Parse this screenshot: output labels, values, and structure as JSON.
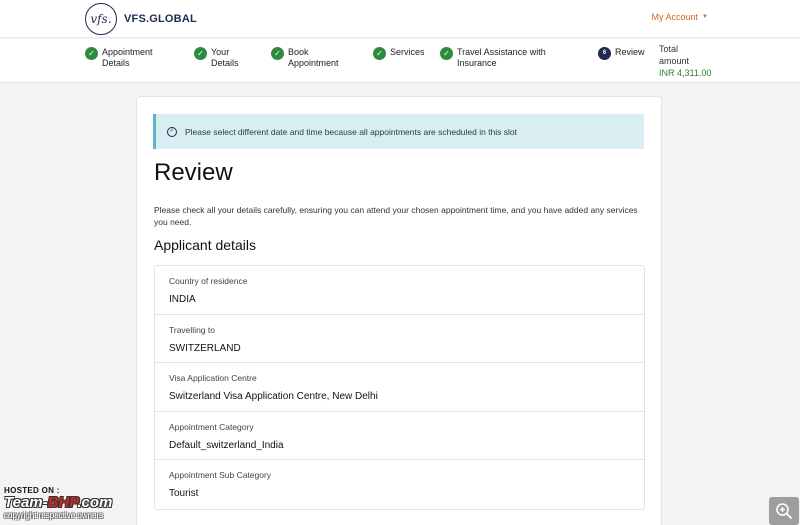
{
  "header": {
    "logo_mark": "vfs.",
    "logo_text": "VFS.GLOBAL",
    "account_label": "My Account"
  },
  "stepper": {
    "steps": [
      {
        "label_line1": "Appointment",
        "label_line2": "Details",
        "status": "done"
      },
      {
        "label_line1": "Your",
        "label_line2": "Details",
        "status": "done"
      },
      {
        "label_line1": "Book",
        "label_line2": "Appointment",
        "status": "done"
      },
      {
        "label_line1": "Services",
        "label_line2": "",
        "status": "done"
      },
      {
        "label_line1": "Travel Assistance with",
        "label_line2": "Insurance",
        "status": "done"
      },
      {
        "label_line1": "Review",
        "label_line2": "",
        "status": "current",
        "number": "6"
      }
    ],
    "total_label_line1": "Total",
    "total_label_line2": "amount",
    "total_amount": "INR 4,311.00"
  },
  "alert": {
    "text": "Please select different date and time because all appointments are scheduled in this slot"
  },
  "main": {
    "title": "Review",
    "intro": "Please check all your details carefully, ensuring you can attend your chosen appointment time, and you have added any services you need.",
    "section_title": "Applicant details",
    "details": [
      {
        "label": "Country of residence",
        "value": "INDIA"
      },
      {
        "label": "Travelling to",
        "value": "SWITZERLAND"
      },
      {
        "label": "Visa Application Centre",
        "value": "Switzerland Visa Application Centre, New Delhi"
      },
      {
        "label": "Appointment Category",
        "value": "Default_switzerland_India"
      },
      {
        "label": "Appointment Sub Category",
        "value": "Tourist"
      }
    ]
  },
  "watermark": {
    "hosted": "HOSTED ON :",
    "brand_prefix": "Team-",
    "brand_bhp": "BHP",
    "brand_suffix": ".com",
    "copyright": "copyright respective owners"
  },
  "icons": {
    "step_done": "checkmark-circle-icon",
    "alert": "check-circle-icon",
    "zoom": "zoom-in-icon"
  },
  "colors": {
    "brand_navy": "#1f2a55",
    "account_orange": "#d2691e",
    "step_green": "#2e8b3e",
    "amount_green": "#2e7d32",
    "alert_bg": "#d9eef1"
  }
}
